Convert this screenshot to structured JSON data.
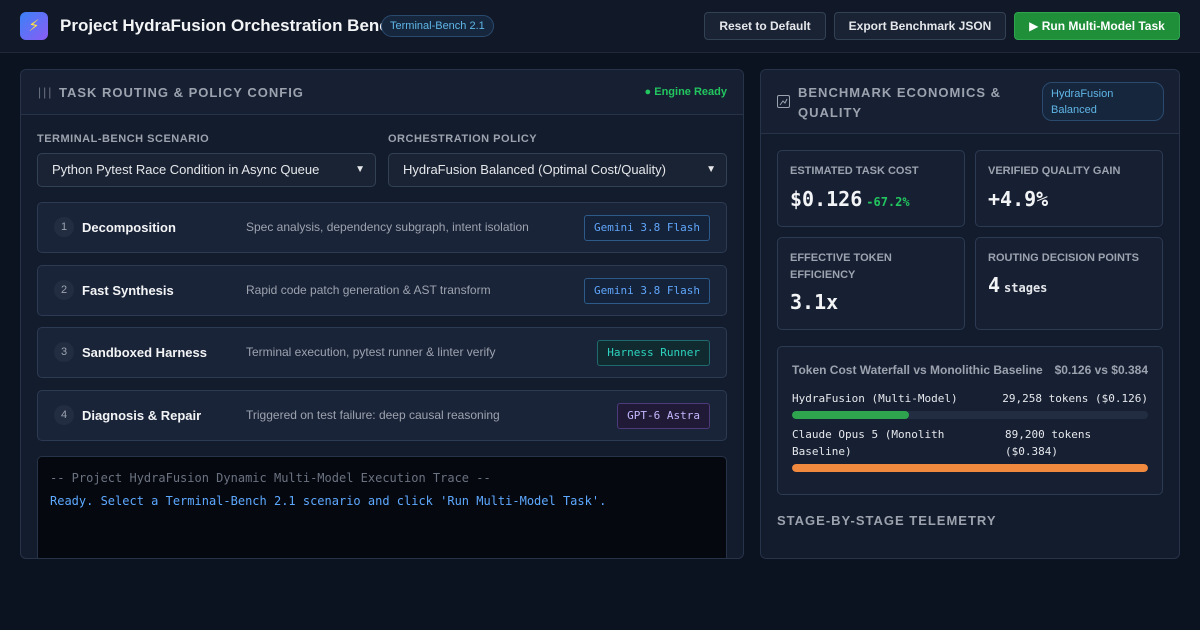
{
  "header": {
    "logo_icon": "lightning-icon",
    "title": "Project HydraFusion Orchestration Bench",
    "version_badge": "Terminal-Bench 2.1",
    "buttons": {
      "reset": "Reset to Default",
      "export": "Export Benchmark JSON",
      "run": "▶ Run Multi-Model Task"
    }
  },
  "left_panel": {
    "icon": "bars-icon",
    "title": "Task Routing & Policy Config",
    "status": "● Engine Ready",
    "scenario": {
      "label": "Terminal-Bench Scenario",
      "value": "Python Pytest Race Condition in Async Queue"
    },
    "policy": {
      "label": "Orchestration Policy",
      "value": "HydraFusion Balanced (Optimal Cost/Quality)"
    },
    "stages": [
      {
        "num": "1",
        "name": "Decomposition",
        "desc": "Spec analysis, dependency subgraph, intent isolation",
        "model": "Gemini 3.8 Flash"
      },
      {
        "num": "2",
        "name": "Fast Synthesis",
        "desc": "Rapid code patch generation & AST transform",
        "model": "Gemini 3.8 Flash"
      },
      {
        "num": "3",
        "name": "Sandboxed Harness",
        "desc": "Terminal execution, pytest runner & linter verify",
        "model": "Harness Runner"
      },
      {
        "num": "4",
        "name": "Diagnosis & Repair",
        "desc": "Triggered on test failure: deep causal reasoning",
        "model": "GPT-6 Astra"
      }
    ],
    "terminal": {
      "line1": "-- Project HydraFusion Dynamic Multi-Model Execution Trace --",
      "line2": "Ready. Select a Terminal-Bench 2.1 scenario and click 'Run Multi-Model Task'."
    }
  },
  "right_panel": {
    "icon": "chart-icon",
    "title": "Benchmark Economics & Quality",
    "policy_badge": "HydraFusion Balanced",
    "metrics": {
      "cost": {
        "label": "Estimated Task Cost",
        "value": "$0.126",
        "delta": "-67.2%"
      },
      "quality": {
        "label": "Verified Quality Gain",
        "value": "+4.9%"
      },
      "efficiency": {
        "label": "Effective Token Efficiency",
        "value": "3.1x"
      },
      "routing": {
        "label": "Routing Decision Points",
        "value": "4",
        "unit": "stages"
      }
    },
    "waterfall": {
      "title": "Token Cost Waterfall vs Monolithic Baseline",
      "summary": "$0.126 vs $0.384",
      "rows": [
        {
          "name": "HydraFusion (Multi-Model)",
          "tokens": "29,258 tokens ($0.126)",
          "fraction": 0.328,
          "color": "#2ea44f"
        },
        {
          "name": "Claude Opus 5 (Monolith Baseline)",
          "tokens": "89,200 tokens ($0.384)",
          "fraction": 1.0,
          "color": "#f0883e"
        }
      ]
    },
    "telemetry_title": "Stage-by-Stage Telemetry"
  }
}
